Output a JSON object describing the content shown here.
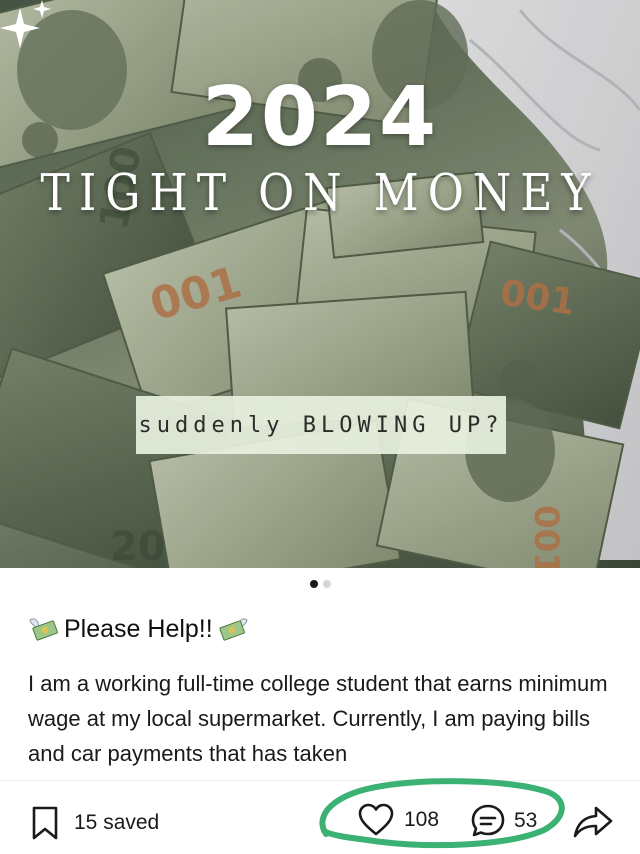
{
  "hero": {
    "year": "2024",
    "subtitle": "TIGHT ON MONEY",
    "caption": "suddenly BLOWING UP?",
    "icons": [
      "sparkle-icon"
    ]
  },
  "pager": {
    "total": 2,
    "active": 1
  },
  "post": {
    "title": "Please Help!!",
    "title_emoji": "money-with-wings-icon",
    "body": "I am a working full-time college student that earns minimum wage at my local supermarket. Currently, I am paying bills and car payments that has taken"
  },
  "actions": {
    "saved_label": "15 saved",
    "likes": "108",
    "comments": "53"
  },
  "colors": {
    "annotation": "#3bb273",
    "text": "#1a1a1a",
    "caption_bg": "#e8f0de"
  }
}
